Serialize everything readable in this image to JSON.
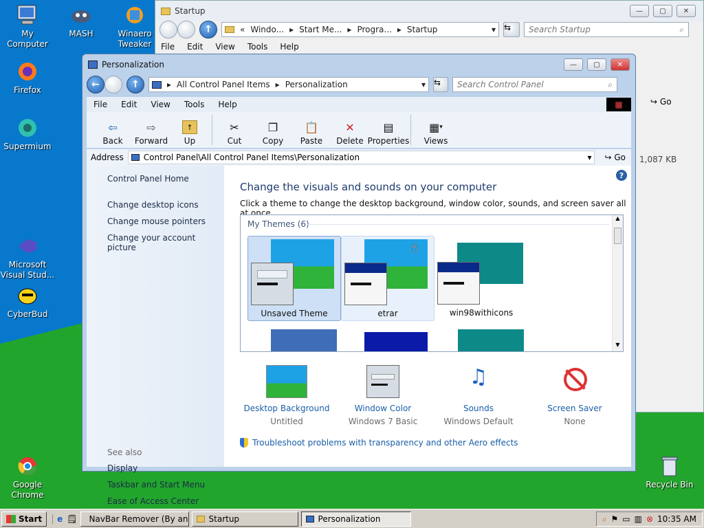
{
  "desktop": {
    "icons": [
      {
        "label": "My Computer"
      },
      {
        "label": "MASH"
      },
      {
        "label": "Winaero Tweaker"
      },
      {
        "label": "Firefox"
      },
      {
        "label": "Supermium"
      },
      {
        "label": "Microsoft Visual Stud..."
      },
      {
        "label": "CyberBud"
      },
      {
        "label": "Google Chrome"
      },
      {
        "label": "Recycle Bin"
      }
    ]
  },
  "startup_window": {
    "title": "Startup",
    "breadcrumb": [
      "Windo...",
      "Start Me...",
      "Progra...",
      "Startup"
    ],
    "search_placeholder": "Search Startup",
    "menu": [
      "File",
      "Edit",
      "View",
      "Tools",
      "Help"
    ],
    "go_label": "Go",
    "size_text": "1,087 KB"
  },
  "personalization": {
    "title": "Personalization",
    "breadcrumb": [
      "All Control Panel Items",
      "Personalization"
    ],
    "search_placeholder": "Search Control Panel",
    "menu": [
      "File",
      "Edit",
      "View",
      "Tools",
      "Help"
    ],
    "toolbar": {
      "back": "Back",
      "forward": "Forward",
      "up": "Up",
      "cut": "Cut",
      "copy": "Copy",
      "paste": "Paste",
      "delete": "Delete",
      "properties": "Properties",
      "views": "Views"
    },
    "address_label": "Address",
    "address_value": "Control Panel\\All Control Panel Items\\Personalization",
    "go_label": "Go",
    "left_pane": {
      "home": "Control Panel Home",
      "links": [
        "Change desktop icons",
        "Change mouse pointers",
        "Change your account picture"
      ],
      "see_also_title": "See also",
      "see_also": [
        "Display",
        "Taskbar and Start Menu",
        "Ease of Access Center"
      ]
    },
    "heading": "Change the visuals and sounds on your computer",
    "subheading": "Click a theme to change the desktop background, window color, sounds, and screen saver all at once.",
    "themes_group": "My Themes (6)",
    "themes": [
      {
        "name": "Unsaved Theme"
      },
      {
        "name": "etrar"
      },
      {
        "name": "win98withicons"
      }
    ],
    "settings": [
      {
        "label": "Desktop Background",
        "value": "Untitled"
      },
      {
        "label": "Window Color",
        "value": "Windows 7 Basic"
      },
      {
        "label": "Sounds",
        "value": "Windows Default"
      },
      {
        "label": "Screen Saver",
        "value": "None"
      }
    ],
    "troubleshoot": "Troubleshoot problems with transparency and other Aero effects"
  },
  "taskbar": {
    "start": "Start",
    "tasks": [
      {
        "label": "NavBar Remover (By ani..."
      },
      {
        "label": "Startup"
      },
      {
        "label": "Personalization"
      }
    ],
    "clock": "10:35 AM"
  },
  "colors": {
    "desktop_blue": "#0878cc",
    "desktop_green": "#22a52c",
    "link_blue": "#1a5ea8",
    "heading_blue": "#1e3b6e"
  }
}
